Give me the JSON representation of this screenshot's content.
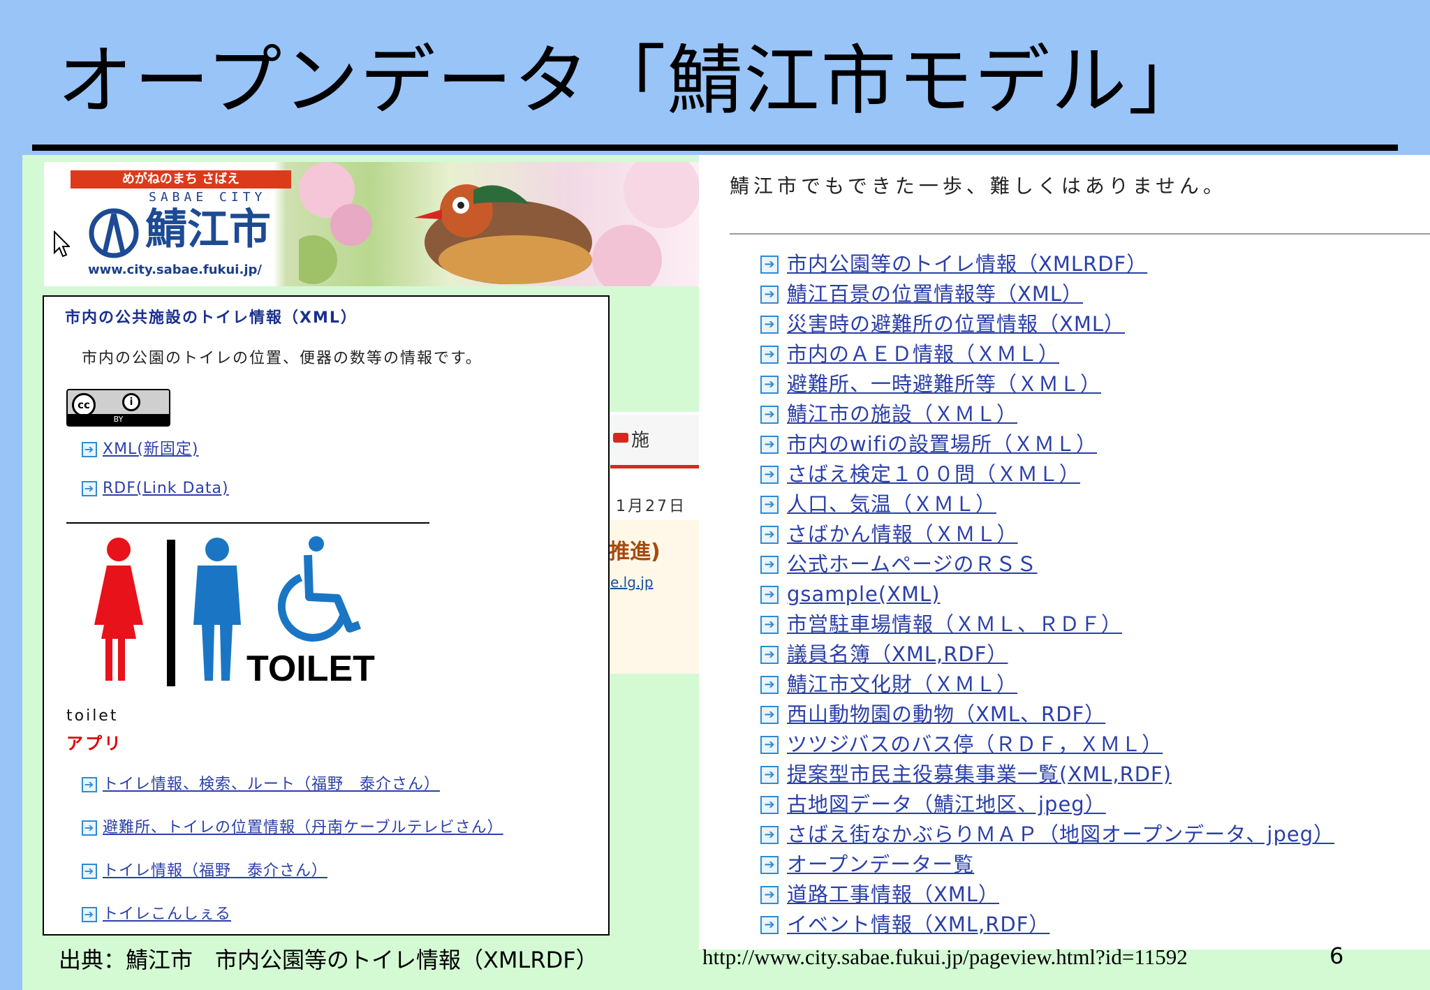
{
  "slide": {
    "title": "オープンデータ「鯖江市モデル」",
    "page_number": "6"
  },
  "banner": {
    "tagline": "めがねのまち さばえ",
    "city_romaji": "SABAE CITY",
    "city_name": "鯖江市",
    "city_url": "www.city.sabae.fukui.jp/"
  },
  "background_page": {
    "tab_label": "施",
    "date": "1月27日",
    "heading": "推進)",
    "link": "e.lg.jp"
  },
  "toilet_panel": {
    "title": "市内の公共施設のトイレ情報（XML）",
    "description": "市内の公園のトイレの位置、便器の数等の情報です。",
    "license_badge": "BY",
    "downloads": [
      "XML(新固定)",
      "RDF(Link Data)"
    ],
    "sign_label": "TOILET",
    "small_label": "toilet",
    "apps_heading": "アプリ",
    "apps": [
      "トイレ情報、検索、ルート（福野　泰介さん）",
      "避難所、トイレの位置情報（丹南ケーブルテレビさん）",
      "トイレ情報（福野　泰介さん）",
      "トイレこんしぇる"
    ]
  },
  "link_panel": {
    "heading": "鯖江市でもできた一歩、難しくはありません。",
    "links": [
      "市内公園等のトイレ情報（XMLRDF）",
      "鯖江百景の位置情報等（XML）",
      "災害時の避難所の位置情報（XML）",
      "市内のＡＥＤ情報（ＸＭＬ）",
      "避難所、一時避難所等（ＸＭＬ）",
      "鯖江市の施設（ＸＭＬ）",
      "市内のwifiの設置場所（ＸＭＬ）",
      "さばえ検定１００問（ＸＭＬ）",
      "人口、気温（ＸＭＬ）",
      "さばかん情報（ＸＭＬ）",
      "公式ホームページのＲＳＳ",
      "gsample(XML)",
      "市営駐車場情報（ＸＭＬ、ＲＤＦ）",
      "議員名簿（XML,RDF）",
      "鯖江市文化財（ＸＭＬ）",
      "西山動物園の動物（XML、RDF）",
      "ツツジバスのバス停（ＲＤＦ，ＸＭＬ）",
      "提案型市民主役募集事業一覧(XML,RDF)",
      "古地図データ（鯖江地区、jpeg）",
      "さばえ街なかぶらりＭＡＰ（地図オープンデータ、jpeg）",
      "オープンデーター覧",
      "道路工事情報（XML）",
      "イベント情報（XML,RDF）"
    ]
  },
  "footer": {
    "source": "出典：鯖江市　市内公園等のトイレ情報（XMLRDF）",
    "url": "http://www.city.sabae.fukui.jp/pageview.html?id=11592"
  },
  "colors": {
    "slide_background": "#99c4f8",
    "content_background": "#d4fad4",
    "link_blue": "#2a3fa8",
    "toilet_female": "#e8121a",
    "toilet_male": "#1a76c4",
    "tagline_red": "#dd3a1c"
  }
}
